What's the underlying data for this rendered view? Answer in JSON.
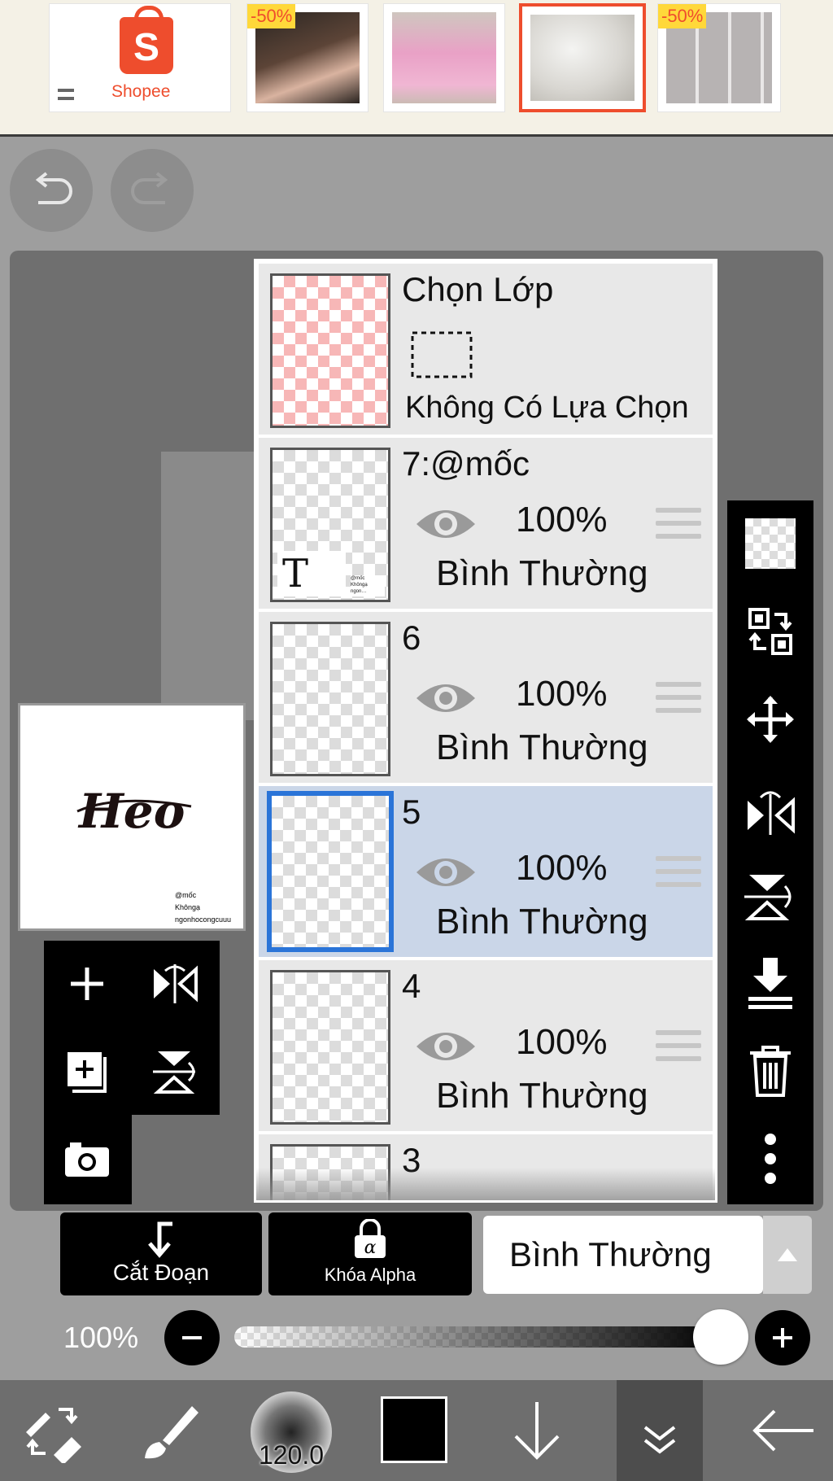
{
  "ad": {
    "brand": "Shopee",
    "badges": [
      "-50%",
      "-50%"
    ]
  },
  "layers_panel": {
    "selection": {
      "title": "Chọn Lớp",
      "status": "Không Có Lựa Chọn"
    },
    "layers": [
      {
        "name": "7:@mốc",
        "opacity": "100%",
        "blend": "Bình Thường",
        "selected": false
      },
      {
        "name": "6",
        "opacity": "100%",
        "blend": "Bình Thường",
        "selected": false
      },
      {
        "name": "5",
        "opacity": "100%",
        "blend": "Bình Thường",
        "selected": true
      },
      {
        "name": "4",
        "opacity": "100%",
        "blend": "Bình Thường",
        "selected": false
      },
      {
        "name": "3"
      }
    ]
  },
  "preview": {
    "artwork_text": "Heo",
    "watermark_lines": [
      "@mốc",
      "Khôngạ",
      "ngonhocongcuuu"
    ]
  },
  "controls": {
    "clipping_label": "Cắt Đoạn",
    "alpha_lock_label": "Khóa Alpha",
    "blend_mode": "Bình Thường",
    "opacity_label": "100%",
    "opacity_value": 100
  },
  "toolbar": {
    "brush_size": "120.0",
    "color": "#000000"
  }
}
